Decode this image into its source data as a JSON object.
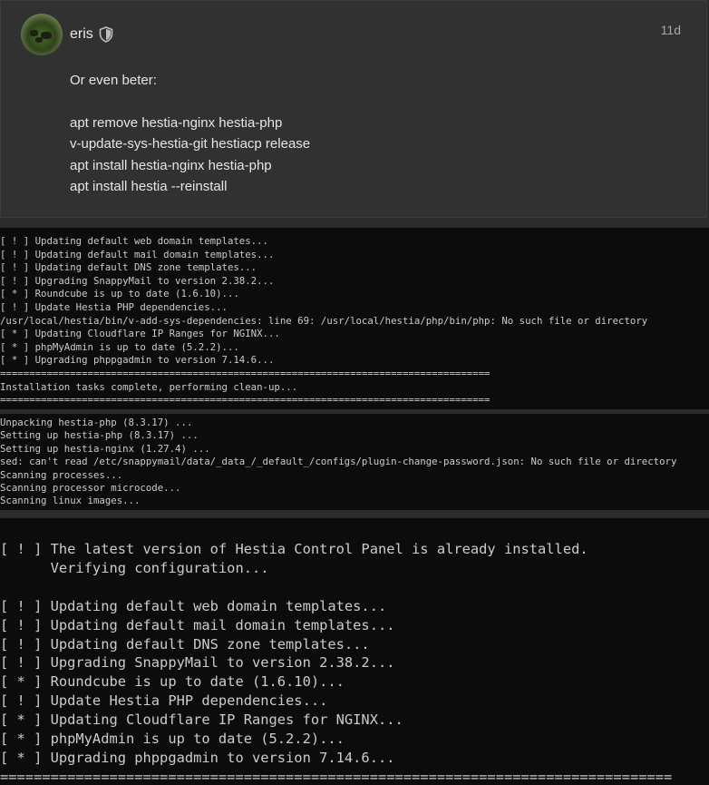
{
  "post": {
    "username": "eris",
    "date": "11d",
    "lines": [
      "Or even beter:",
      "apt remove hestia-nginx hestia-php",
      "v-update-sys-hestia-git hestiacp release",
      "apt install hestia-nginx hestia-php",
      "apt install hestia --reinstall"
    ]
  },
  "terminal1": [
    "[ ! ] Updating default web domain templates...",
    "[ ! ] Updating default mail domain templates...",
    "[ ! ] Updating default DNS zone templates...",
    "[ ! ] Upgrading SnappyMail to version 2.38.2...",
    "[ * ] Roundcube is up to date (1.6.10)...",
    "[ ! ] Update Hestia PHP dependencies...",
    "/usr/local/hestia/bin/v-add-sys-dependencies: line 69: /usr/local/hestia/php/bin/php: No such file or directory",
    "[ * ] Updating Cloudflare IP Ranges for NGINX...",
    "[ * ] phpMyAdmin is up to date (5.2.2)...",
    "[ * ] Upgrading phppgadmin to version 7.14.6...",
    "====================================================================================",
    "Installation tasks complete, performing clean-up...",
    "===================================================================================="
  ],
  "terminal2": [
    "Unpacking hestia-php (8.3.17) ...",
    "Setting up hestia-php (8.3.17) ...",
    "Setting up hestia-nginx (1.27.4) ...",
    "sed: can't read /etc/snappymail/data/_data_/_default_/configs/plugin-change-password.json: No such file or directory",
    "Scanning processes...",
    "Scanning processor microcode...",
    "Scanning linux images..."
  ],
  "terminal3": [
    "[ ! ] The latest version of Hestia Control Panel is already installed.",
    "      Verifying configuration...",
    "",
    "[ ! ] Updating default web domain templates...",
    "[ ! ] Updating default mail domain templates...",
    "[ ! ] Updating default DNS zone templates...",
    "[ ! ] Upgrading SnappyMail to version 2.38.2...",
    "[ * ] Roundcube is up to date (1.6.10)...",
    "[ ! ] Update Hestia PHP dependencies...",
    "[ * ] Updating Cloudflare IP Ranges for NGINX...",
    "[ * ] phpMyAdmin is up to date (5.2.2)...",
    "[ * ] Upgrading phppgadmin to version 7.14.6...",
    "================================================================================"
  ],
  "icons": {
    "avatar": "avatar-image",
    "shield": "shield-icon"
  },
  "colors": {
    "post_bg": "#313131",
    "terminal_bg": "#0c0c0c",
    "terminal_fg": "#cccccc"
  }
}
